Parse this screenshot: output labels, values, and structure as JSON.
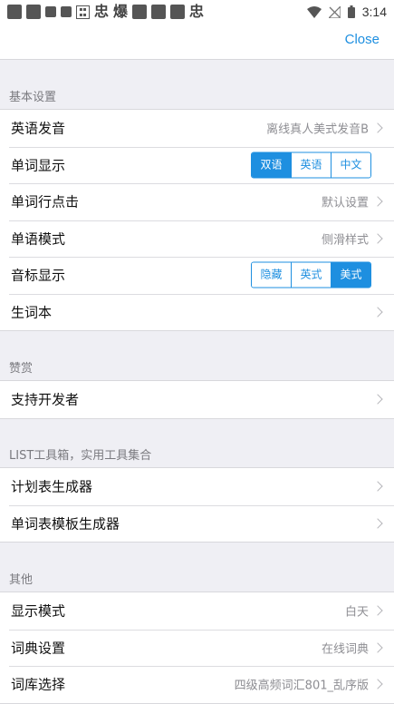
{
  "status_bar": {
    "time": "3:14"
  },
  "nav": {
    "close_label": "Close"
  },
  "sections": {
    "basic": {
      "header": "基本设置",
      "rows": {
        "pronunciation": {
          "label": "英语发音",
          "value": "离线真人美式发音B"
        },
        "word_display": {
          "label": "单词显示",
          "options": [
            "双语",
            "英语",
            "中文"
          ],
          "selected": "双语"
        },
        "row_tap": {
          "label": "单词行点击",
          "value": "默认设置"
        },
        "word_mode": {
          "label": "单语模式",
          "value": "侧滑样式"
        },
        "phonetic": {
          "label": "音标显示",
          "options": [
            "隐藏",
            "英式",
            "美式"
          ],
          "selected": "美式"
        },
        "vocab_book": {
          "label": "生词本"
        }
      }
    },
    "support": {
      "header": "赞赏",
      "rows": {
        "support_dev": {
          "label": "支持开发者"
        }
      }
    },
    "tools": {
      "header": "LIST工具箱，实用工具集合",
      "rows": {
        "plan_gen": {
          "label": "计划表生成器"
        },
        "word_template": {
          "label": "单词表模板生成器"
        }
      }
    },
    "other": {
      "header": "其他",
      "rows": {
        "display_mode": {
          "label": "显示模式",
          "value": "白天"
        },
        "dictionary": {
          "label": "词典设置",
          "value": "在线词典"
        },
        "word_bank": {
          "label": "词库选择",
          "value": "四级高频词汇801_乱序版"
        }
      }
    }
  },
  "colors": {
    "accent": "#1e8fe0",
    "background": "#efeff4",
    "secondary_text": "#8e8e93"
  }
}
